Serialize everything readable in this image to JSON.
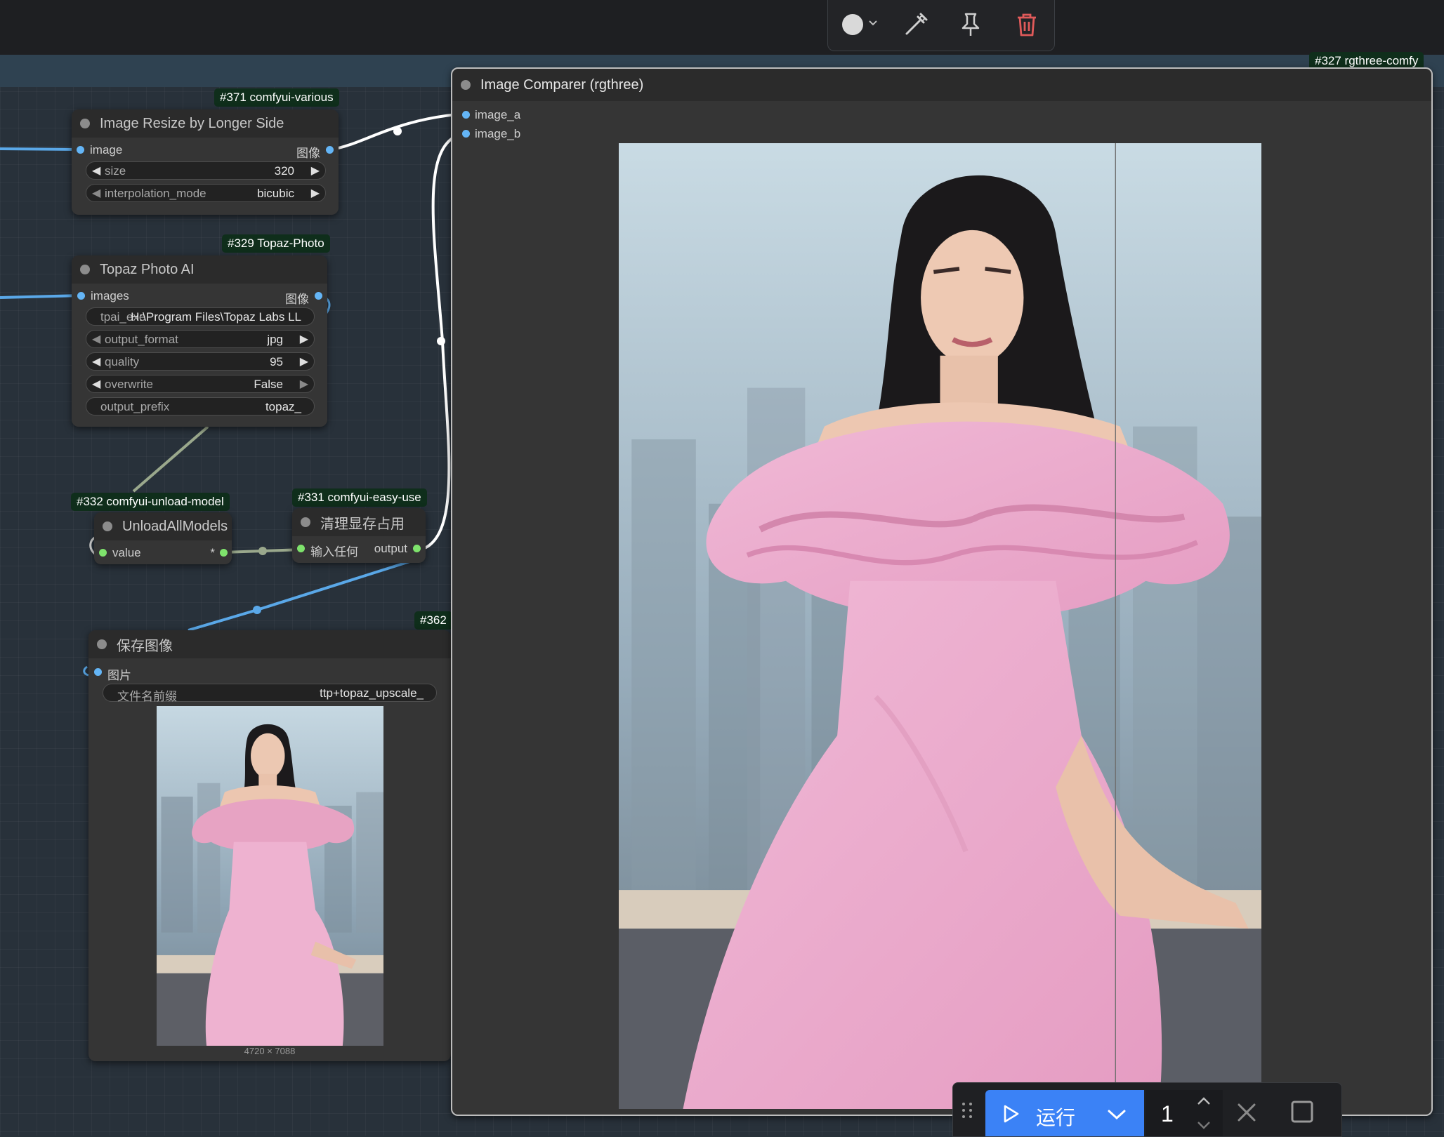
{
  "toolbox": {
    "color_icon": "circle-color-icon",
    "bypass_icon": "bypass-wand-icon",
    "pin_icon": "pin-icon",
    "delete_icon": "trash-icon",
    "delete_color": "#e05a5a"
  },
  "badges": {
    "resize": "#371 comfyui-various",
    "topaz": "#329 Topaz-Photo",
    "unload": "#332 comfyui-unload-model",
    "cleanup": "#331 comfyui-easy-use",
    "save": "#362",
    "comparer": "#327 rgthree-comfy"
  },
  "node_resize": {
    "title": "Image Resize by Longer Side",
    "input": "image",
    "output": "图像",
    "size_label": "size",
    "size_value": "320",
    "interp_label": "interpolation_mode",
    "interp_value": "bicubic"
  },
  "node_topaz": {
    "title": "Topaz Photo AI",
    "input": "images",
    "output": "图像",
    "exe_label": "tpai_exe",
    "exe_value": "H:\\Program Files\\Topaz Labs LL",
    "format_label": "output_format",
    "format_value": "jpg",
    "quality_label": "quality",
    "quality_value": "95",
    "overwrite_label": "overwrite",
    "overwrite_value": "False",
    "prefix_label": "output_prefix",
    "prefix_value": "topaz_"
  },
  "node_unload": {
    "title": "UnloadAllModels",
    "input": "value",
    "output": "*"
  },
  "node_cleanup": {
    "title": "清理显存占用",
    "input": "输入任何",
    "output": "output"
  },
  "node_save": {
    "title": "保存图像",
    "input": "图片",
    "prefix_label": "文件名前缀",
    "prefix_value": "ttp+topaz_upscale_",
    "dimensions": "4720 × 7088"
  },
  "node_comparer": {
    "title": "Image Comparer (rgthree)",
    "input_a": "image_a",
    "input_b": "image_b"
  },
  "runbar": {
    "drag_icon": "drag-handle-icon",
    "run_label": "运行",
    "queue_count": "1",
    "run_color": "#3b82f6",
    "cancel_icon": "close-icon",
    "stop_icon": "stop-icon"
  }
}
